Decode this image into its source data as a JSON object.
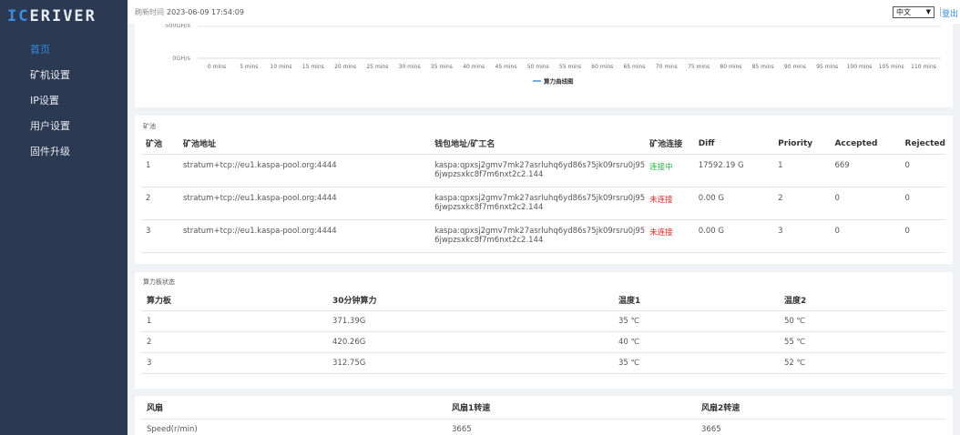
{
  "logo": {
    "part1": "IC",
    "part2": "ERIVER"
  },
  "nav": [
    {
      "label": "首页",
      "active": true
    },
    {
      "label": "矿机设置",
      "active": false
    },
    {
      "label": "IP设置",
      "active": false
    },
    {
      "label": "用户设置",
      "active": false
    },
    {
      "label": "固件升级",
      "active": false
    }
  ],
  "topbar": {
    "refresh_label": "刷新时间",
    "refresh_time": "2023-06-09 17:54:09",
    "language": "中文",
    "logout": "登出"
  },
  "chart_data": {
    "type": "line",
    "y_ticks": [
      "500GH/s",
      "0GH/s"
    ],
    "x": [
      "0 mins",
      "5 mins",
      "10 mins",
      "15 mins",
      "20 mins",
      "25 mins",
      "30 mins",
      "35 mins",
      "40 mins",
      "45 mins",
      "50 mins",
      "55 mins",
      "60 mins",
      "65 mins",
      "70 mins",
      "75 mins",
      "80 mins",
      "85 mins",
      "90 mins",
      "95 mins",
      "100 mins",
      "105 mins",
      "110 mins"
    ],
    "series": [
      {
        "name": "算力曲线图",
        "values": []
      }
    ],
    "legend": "bottom-center",
    "colors": {
      "line": "#4a90d9",
      "axis": "#cccccc"
    }
  },
  "pools": {
    "title": "矿池",
    "headers": [
      "矿池",
      "矿池地址",
      "钱包地址/矿工名",
      "矿池连接",
      "Diff",
      "Priority",
      "Accepted",
      "Rejected"
    ],
    "rows": [
      {
        "id": "1",
        "url": "stratum+tcp://eu1.kaspa-pool.org:4444",
        "worker_l1": "kaspa:qpxsj2gmv7mk27asrluhq6yd86s75jk09rsru0j95",
        "worker_l2": "6jwpzsxkc8f7m6nxt2c2.144",
        "status": "连接中",
        "connected": true,
        "diff": "17592.19 G",
        "priority": "1",
        "accepted": "669",
        "rejected": "0"
      },
      {
        "id": "2",
        "url": "stratum+tcp://eu1.kaspa-pool.org:4444",
        "worker_l1": "kaspa:qpxsj2gmv7mk27asrluhq6yd86s75jk09rsru0j95",
        "worker_l2": "6jwpzsxkc8f7m6nxt2c2.144",
        "status": "未连接",
        "connected": false,
        "diff": "0.00 G",
        "priority": "2",
        "accepted": "0",
        "rejected": "0"
      },
      {
        "id": "3",
        "url": "stratum+tcp://eu1.kaspa-pool.org:4444",
        "worker_l1": "kaspa:qpxsj2gmv7mk27asrluhq6yd86s75jk09rsru0j95",
        "worker_l2": "6jwpzsxkc8f7m6nxt2c2.144",
        "status": "未连接",
        "connected": false,
        "diff": "0.00 G",
        "priority": "3",
        "accepted": "0",
        "rejected": "0"
      }
    ]
  },
  "boards": {
    "title": "算力板状态",
    "headers": [
      "算力板",
      "30分钟算力",
      "温度1",
      "温度2"
    ],
    "rows": [
      {
        "id": "1",
        "hashrate": "371.39G",
        "temp1": "35 ℃",
        "temp2": "50 ℃"
      },
      {
        "id": "2",
        "hashrate": "420.26G",
        "temp1": "40 ℃",
        "temp2": "55 ℃"
      },
      {
        "id": "3",
        "hashrate": "312.75G",
        "temp1": "35 ℃",
        "temp2": "52 ℃"
      }
    ]
  },
  "fans": {
    "headers": [
      "风扇",
      "风扇1转速",
      "风扇2转速"
    ],
    "rows": [
      {
        "label": "Speed(r/min)",
        "fan1": "3665",
        "fan2": "3665"
      }
    ]
  }
}
